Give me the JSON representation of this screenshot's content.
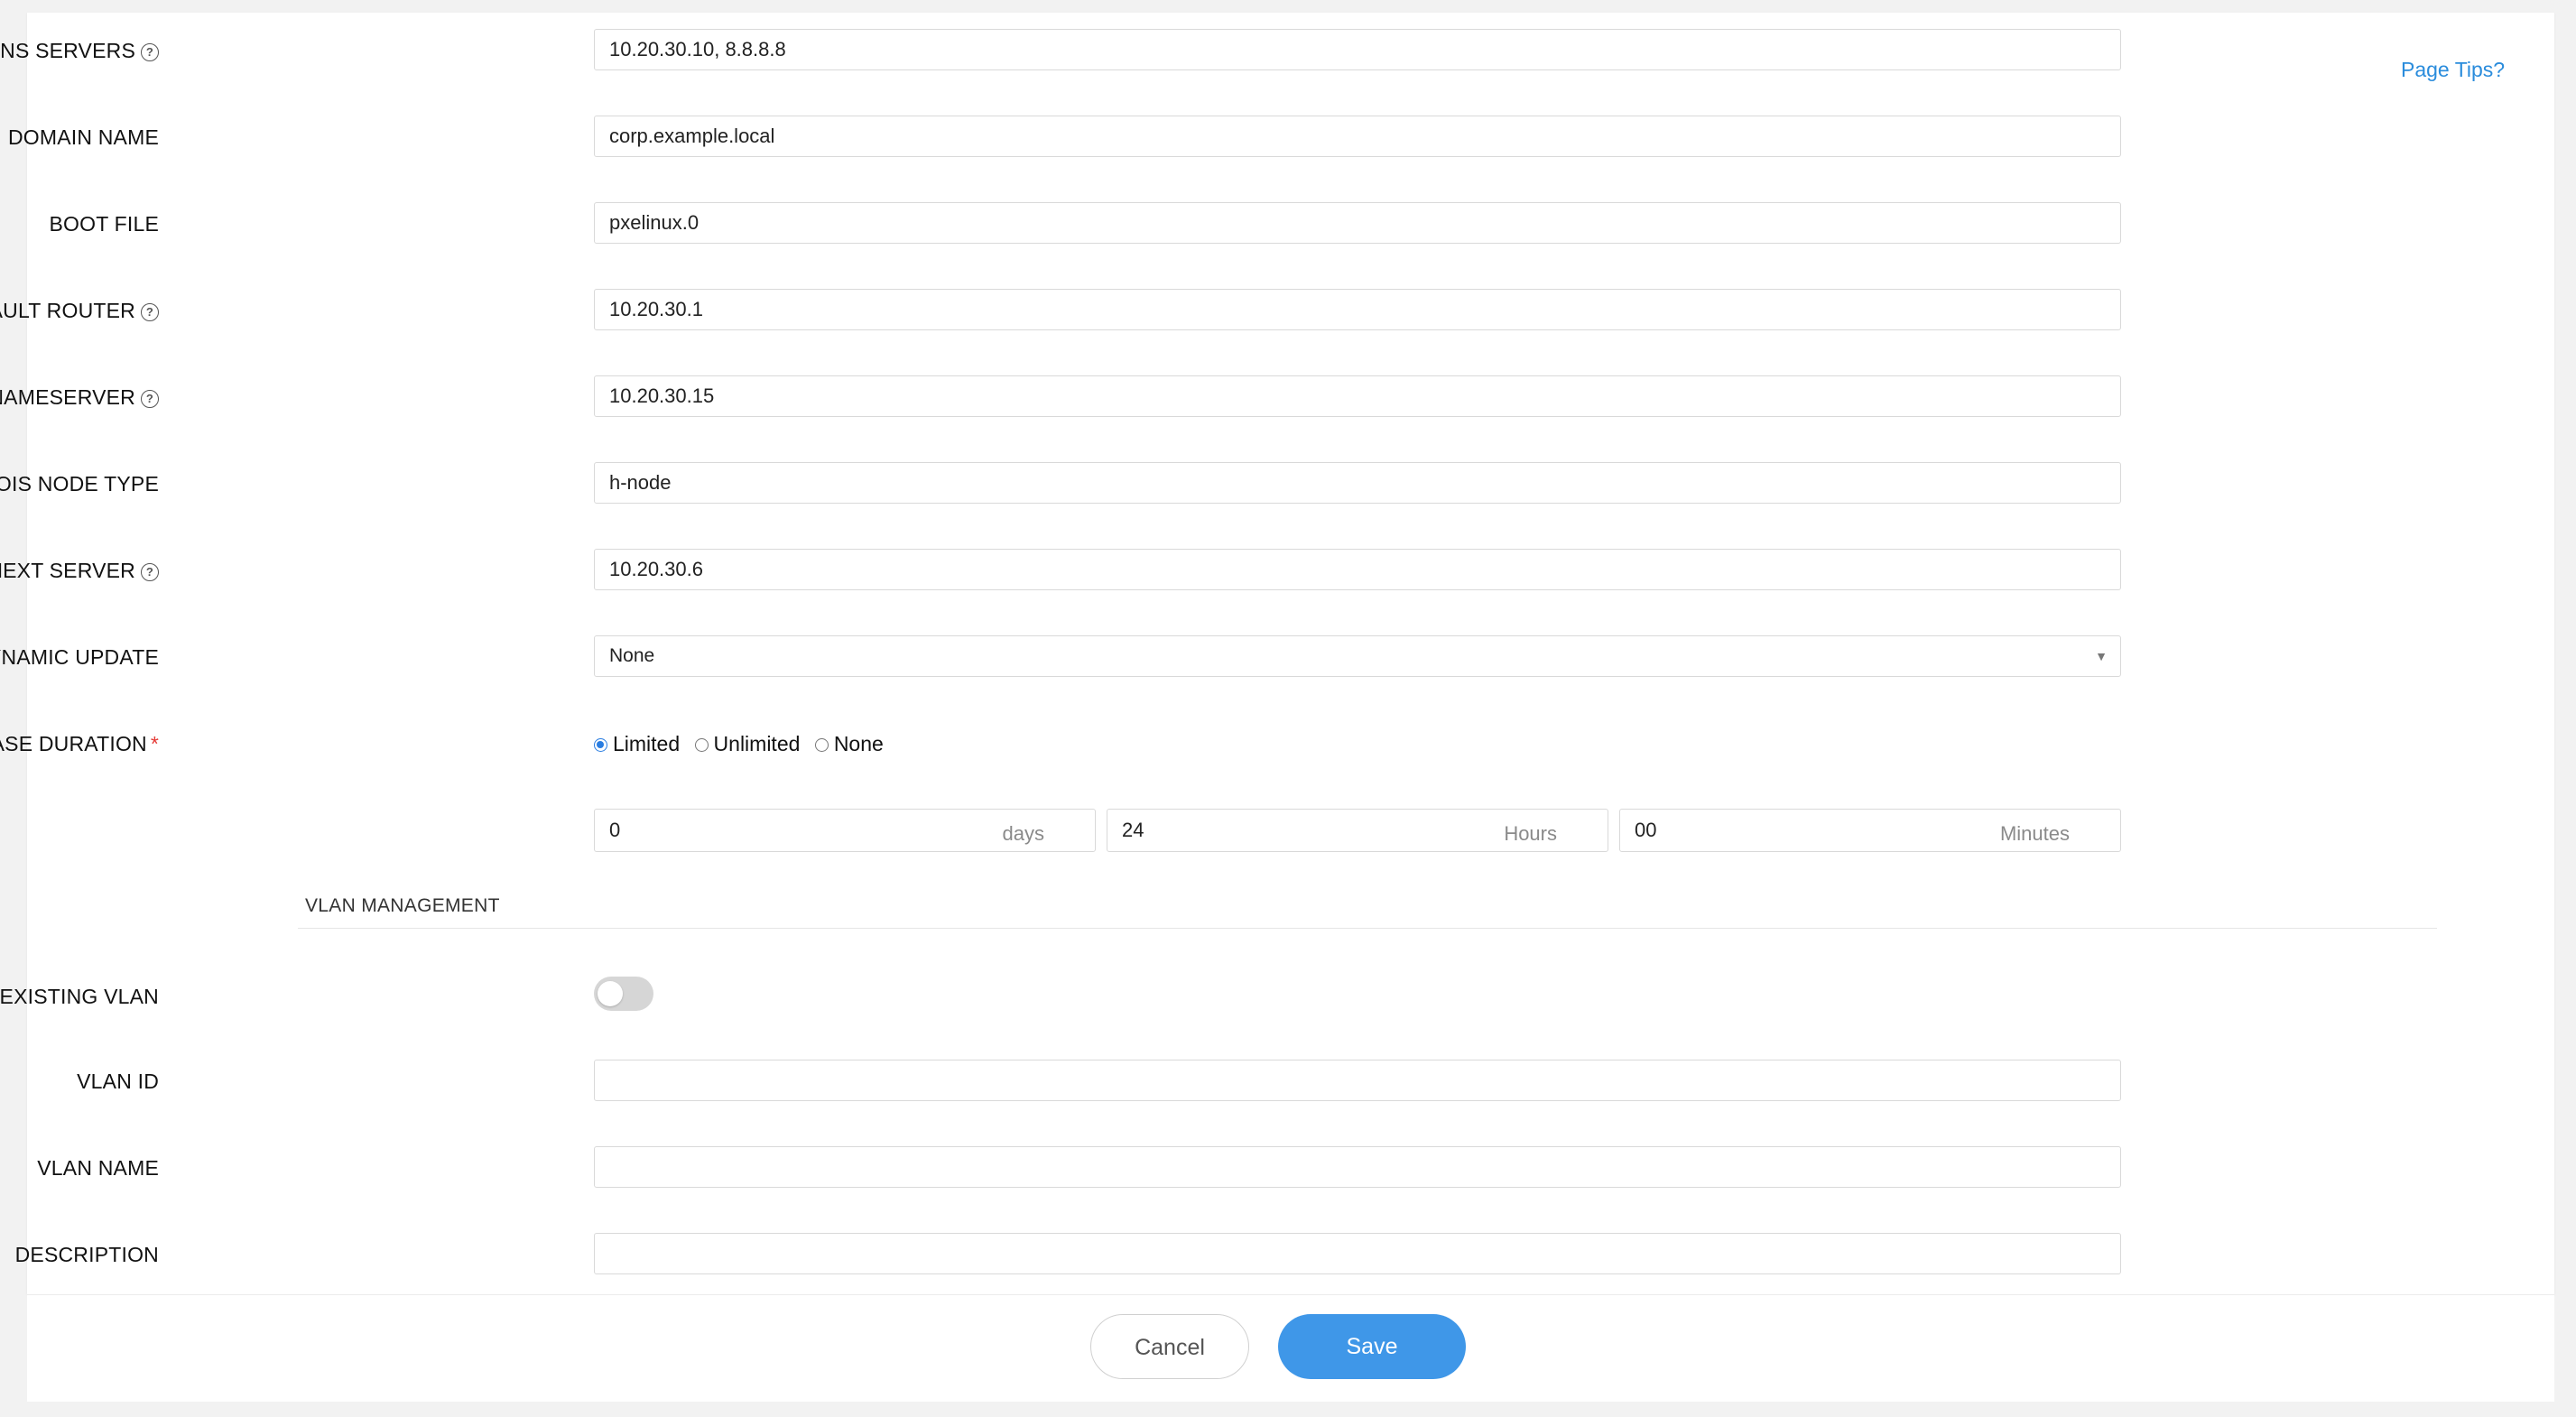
{
  "page_tips": "Page Tips?",
  "fields": {
    "dns_servers": {
      "label": "DNS SERVERS",
      "value": "10.20.30.10, 8.8.8.8"
    },
    "domain_name": {
      "label": "DOMAIN NAME",
      "value": "corp.example.local"
    },
    "boot_file": {
      "label": "BOOT FILE",
      "value": "pxelinux.0"
    },
    "default_router": {
      "label": "DEFAULT ROUTER",
      "value": "10.20.30.1"
    },
    "netbois_nameserver": {
      "label": "NETBOIS NAMESERVER",
      "value": "10.20.30.15"
    },
    "netbois_node_type": {
      "label": "NETBOIS NODE TYPE",
      "value": "h-node"
    },
    "next_server": {
      "label": "NEXT SERVER",
      "value": "10.20.30.6"
    },
    "dynamic_update": {
      "label": "DYNAMIC UPDATE",
      "value": "None"
    },
    "lease_duration": {
      "label": "LEASE DURATION",
      "required_mark": "*",
      "options": [
        "Limited",
        "Unlimited",
        "None"
      ],
      "selected": "Limited",
      "days": {
        "value": "0",
        "unit": "days"
      },
      "hours": {
        "value": "24",
        "unit": "Hours"
      },
      "minutes": {
        "value": "00",
        "unit": "Minutes"
      }
    }
  },
  "vlan": {
    "section_title": "VLAN MANAGEMENT",
    "assign_existing": {
      "label": "ASSIGN EXISTING VLAN",
      "on": false
    },
    "vlan_id": {
      "label": "VLAN ID",
      "value": ""
    },
    "vlan_name": {
      "label": "VLAN NAME",
      "value": ""
    },
    "description": {
      "label": "DESCRIPTION",
      "value": ""
    }
  },
  "help_icon": "?",
  "colors": {
    "accent": "#2a8cdc",
    "save": "#3f97e8",
    "required": "#e53935"
  },
  "buttons": {
    "cancel": "Cancel",
    "save": "Save"
  }
}
